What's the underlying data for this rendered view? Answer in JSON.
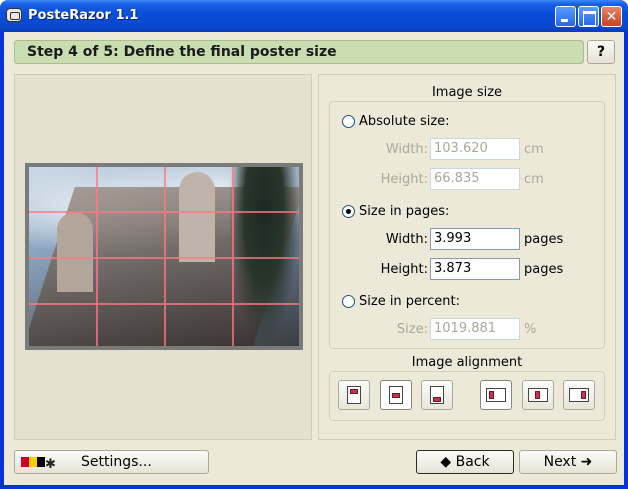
{
  "window": {
    "title": "PosteRazor 1.1"
  },
  "header": {
    "step_title": "Step 4 of 5: Define the final poster size",
    "help_label": "?"
  },
  "image_size": {
    "section_title": "Image size",
    "absolute": {
      "label": "Absolute size:",
      "selected": false,
      "width_label": "Width:",
      "width_value": "103.620",
      "height_label": "Height:",
      "height_value": "66.835",
      "unit": "cm"
    },
    "pages": {
      "label": "Size in pages:",
      "selected": true,
      "width_label": "Width:",
      "width_value": "3.993",
      "height_label": "Height:",
      "height_value": "3.873",
      "unit": "pages"
    },
    "percent": {
      "label": "Size in percent:",
      "selected": false,
      "size_label": "Size:",
      "size_value": "1019.881",
      "unit": "%"
    }
  },
  "image_alignment": {
    "section_title": "Image alignment",
    "buttons": [
      "align-top",
      "align-middle",
      "align-bottom",
      "align-left",
      "align-center",
      "align-right"
    ]
  },
  "footer": {
    "settings_label": "Settings...",
    "back_label": "Back",
    "next_label": "Next"
  }
}
